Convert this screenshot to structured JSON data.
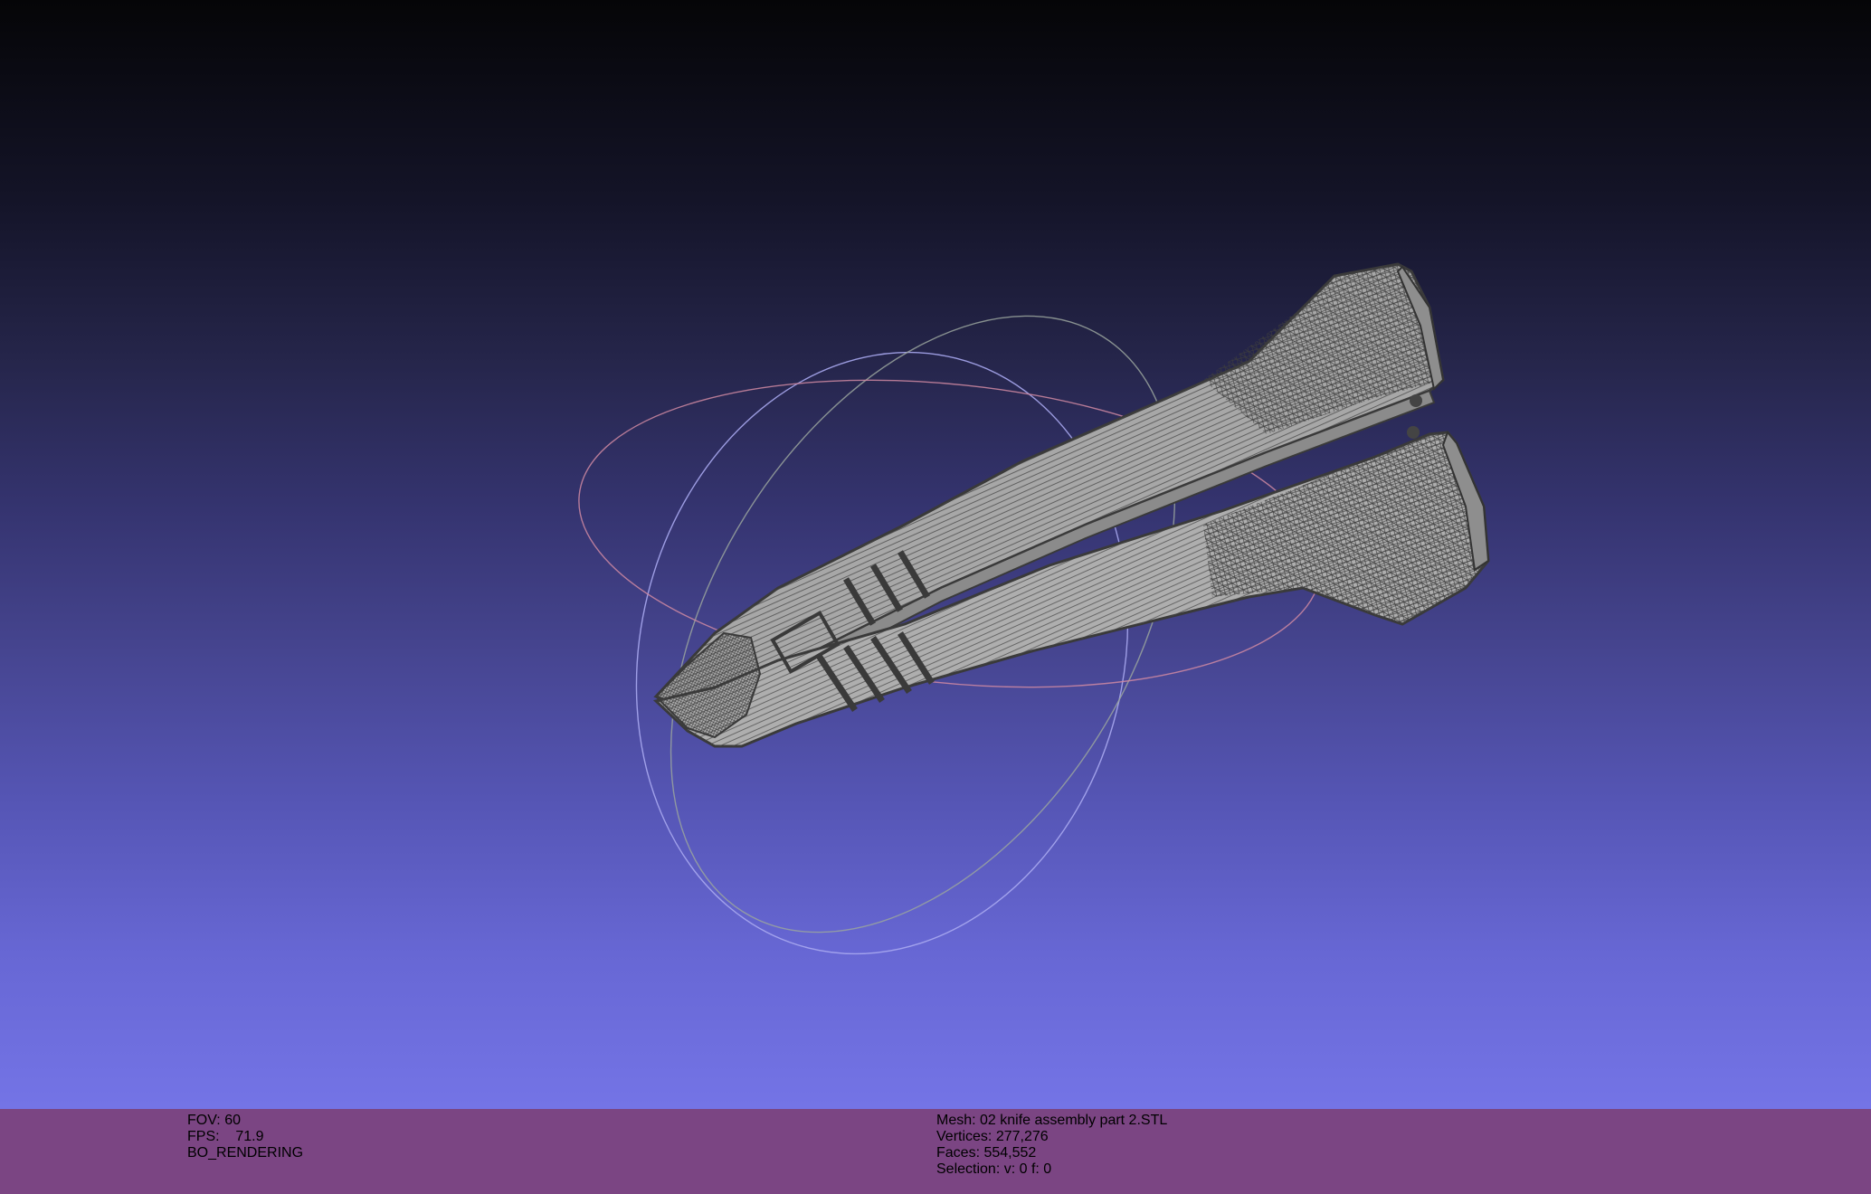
{
  "viewer": {
    "background_top": "#050507",
    "background_bottom": "#7474e6",
    "info_bar_color": "#7b4583",
    "mesh_color": "#a8a8a8",
    "wire_color": "#3c3c3c",
    "trackball_colors": {
      "red_ring": "#d08aa2",
      "green_ring": "#9aa59e",
      "blue_ring": "#a9a9f0"
    }
  },
  "render_info": {
    "fov_label": "FOV:",
    "fov_value": "60",
    "fps_label": "FPS:",
    "fps_value": "71.9",
    "mode": "BO_RENDERING"
  },
  "mesh_info": {
    "mesh_label": "Mesh:",
    "mesh_name": "02 knife assembly part 2.STL",
    "vertices_label": "Vertices:",
    "vertices_value": "277,276",
    "faces_label": "Faces:",
    "faces_value": "554,552",
    "selection_label": "Selection:",
    "selection_value": "v: 0 f: 0"
  }
}
